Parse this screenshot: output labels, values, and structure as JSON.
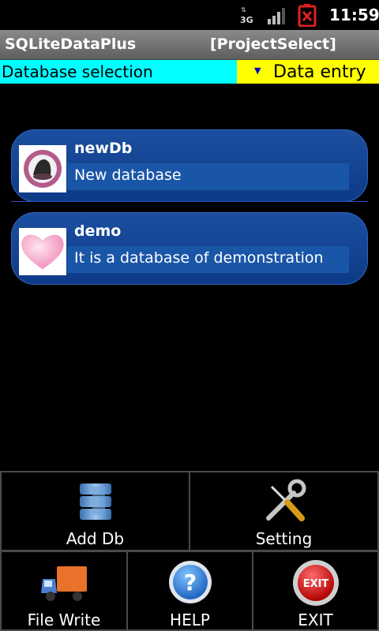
{
  "status_bar": {
    "network": "3G",
    "time": "11:59"
  },
  "title_bar": {
    "app_title": "SQLiteDataPlus",
    "screen_name": "[ProjectSelect]"
  },
  "tabs": {
    "database_selection": "Database selection",
    "data_entry": "Data entry",
    "arrow": "▼"
  },
  "databases": [
    {
      "name": "newDb",
      "description": "New database",
      "icon": "database-logo-icon"
    },
    {
      "name": "demo",
      "description": "It is a database of demonstration",
      "icon": "heart-icon"
    }
  ],
  "buttons": {
    "add_db": "Add Db",
    "setting": "Setting",
    "file_write": "File Write",
    "help": "HELP",
    "exit": "EXIT",
    "exit_icon_text": "EXIT"
  },
  "colors": {
    "tab_db_bg": "#00ffff",
    "tab_entry_bg": "#ffff00",
    "list_item": "#1c4fa0",
    "exit_red": "#cc1111",
    "help_blue": "#1e7bd6"
  }
}
